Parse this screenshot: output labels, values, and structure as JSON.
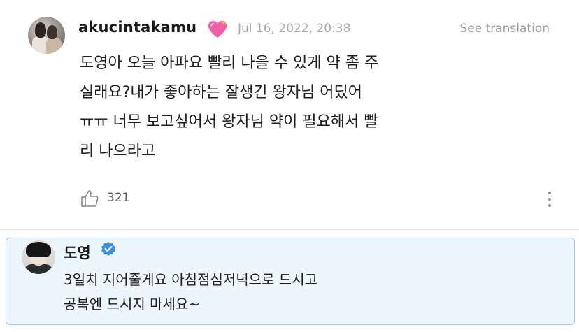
{
  "post": {
    "username": "akucintakamu",
    "username_emoji": "heart-with-sparkles",
    "timestamp": "Jul 16, 2022, 20:38",
    "see_translation": "See translation",
    "message_lines": [
      "도영아 오늘 아파요 빨리 나을 수 있게 약 좀 주",
      "실래요?내가 좋아하는 잘생긴 왕자님 어딨어",
      "ㅠㅠ 너무 보고싶어서 왕자님 약이 필요해서 빨",
      "리 나으라고"
    ],
    "like_count": "321"
  },
  "reply": {
    "name": "도영",
    "verified": true,
    "text_lines": [
      "3일치 지어줄게요 아침점심저녁으로 드시고",
      "공복엔 드시지 마세요~"
    ]
  },
  "colors": {
    "reply_background": "#eef6fd",
    "reply_border": "#9fc9ef",
    "verified_badge": "#3d8fe0",
    "heart": "#f05fa5"
  }
}
